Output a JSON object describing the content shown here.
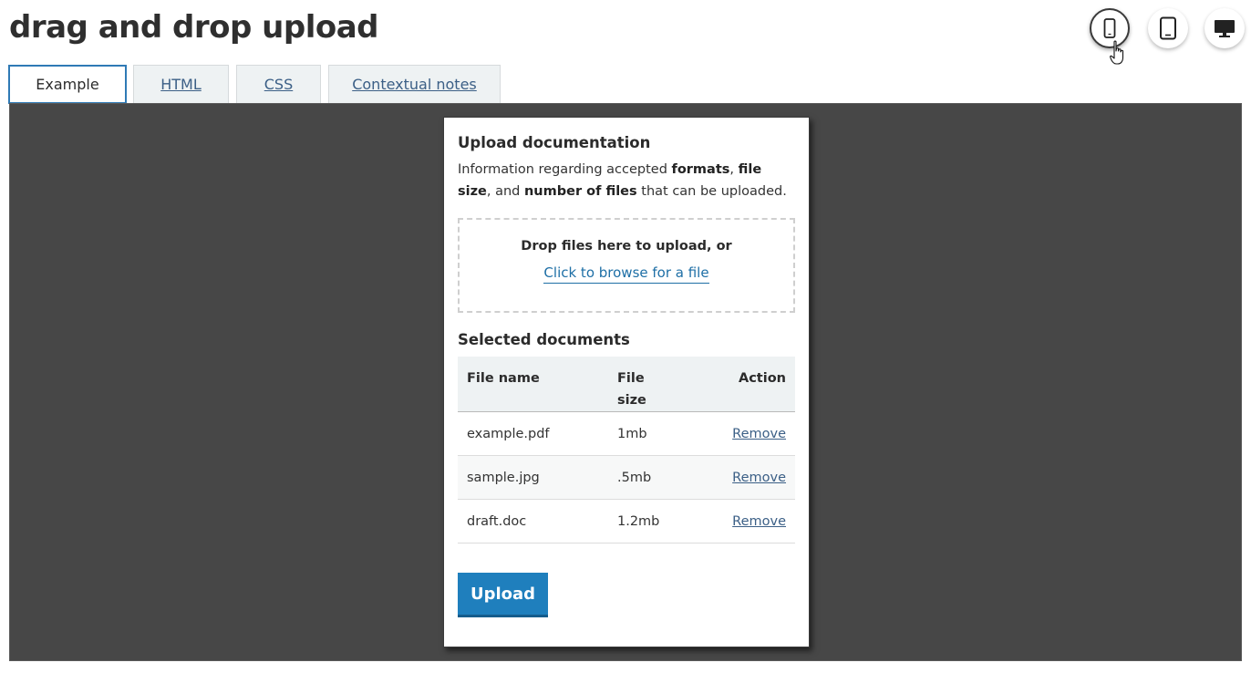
{
  "page": {
    "title": "drag and drop upload"
  },
  "device_toggle": {
    "items": [
      {
        "name": "mobile",
        "icon": "mobile-icon",
        "active": true
      },
      {
        "name": "tablet",
        "icon": "tablet-icon",
        "active": false
      },
      {
        "name": "desktop",
        "icon": "desktop-icon",
        "active": false
      }
    ]
  },
  "tabs": [
    {
      "label": "Example",
      "selected": true
    },
    {
      "label": "HTML",
      "selected": false
    },
    {
      "label": "CSS",
      "selected": false
    },
    {
      "label": "Contextual notes",
      "selected": false
    }
  ],
  "upload": {
    "heading": "Upload documentation",
    "info_prefix": "Information regarding accepted ",
    "info_formats": "formats",
    "info_sep": ", ",
    "info_size": "file size",
    "info_and": ", and ",
    "info_number": "number of files",
    "info_suffix": " that can be uploaded.",
    "drop_text": "Drop files here to upload, or",
    "browse_label": "Click to browse for a file",
    "selected_heading": "Selected documents",
    "columns": {
      "file_name": "File name",
      "file_size_line1": "File",
      "file_size_line2": "size",
      "action": "Action"
    },
    "files": [
      {
        "name": "example.pdf",
        "size": "1mb",
        "action": "Remove"
      },
      {
        "name": "sample.jpg",
        "size": ".5mb",
        "action": "Remove"
      },
      {
        "name": "draft.doc",
        "size": "1.2mb",
        "action": "Remove"
      }
    ],
    "upload_label": "Upload"
  },
  "colors": {
    "accent": "#1f7fbd",
    "link": "#1e6fa6",
    "preview_bg": "#474747",
    "tab_border_selected": "#2f7ab5"
  }
}
